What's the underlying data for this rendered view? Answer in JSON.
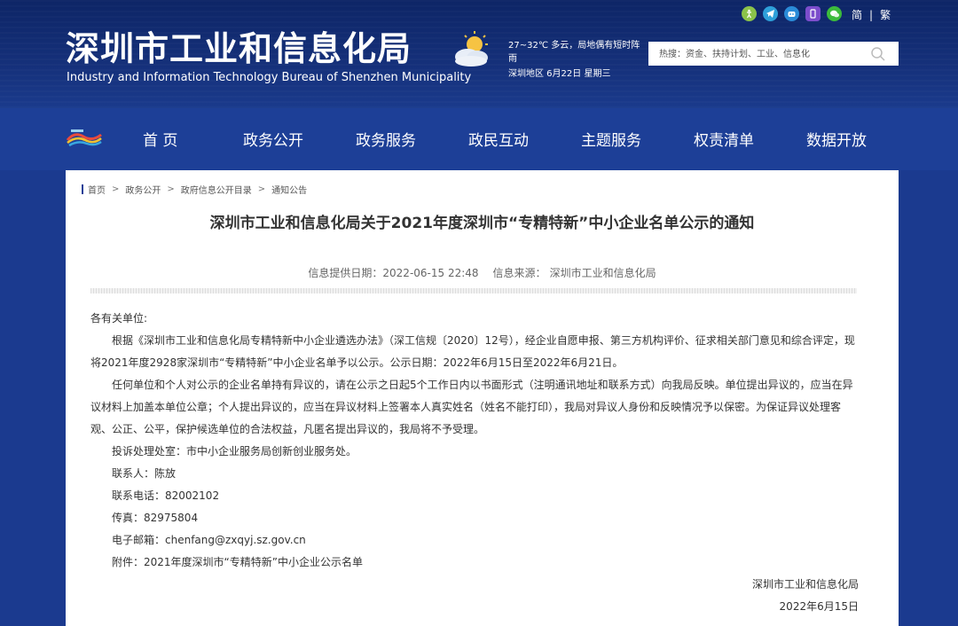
{
  "header": {
    "title": "深圳市工业和信息化局",
    "subtitle": "Industry and Information Technology Bureau of Shenzhen Municipality",
    "weather": {
      "summary": "27~32℃ 多云，局地偶有短时阵雨",
      "date_line": "深圳地区 6月22日 星期三"
    },
    "search_placeholder": "热搜：资金、扶持计划、工业、信息化",
    "lang": {
      "simplified": "简",
      "separator": "|",
      "traditional": "繁"
    },
    "icons": [
      {
        "name": "accessibility-icon",
        "color": "#8bc34a"
      },
      {
        "name": "telegram-icon",
        "color": "#2ea0da"
      },
      {
        "name": "robot-icon",
        "color": "#2a8bd8"
      },
      {
        "name": "mobile-icon",
        "color": "#7c4dcc"
      },
      {
        "name": "wechat-icon",
        "color": "#3cbb3c"
      }
    ]
  },
  "nav": {
    "items": [
      "首 页",
      "政务公开",
      "政务服务",
      "政民互动",
      "主题服务",
      "权责清单",
      "数据开放"
    ]
  },
  "breadcrumb": [
    "首页",
    "政务公开",
    "政府信息公开目录",
    "通知公告"
  ],
  "breadcrumb_sep": ">",
  "article": {
    "title": "深圳市工业和信息化局关于2021年度深圳市“专精特新”中小企业名单公示的通知",
    "date_label": "信息提供日期：2022-06-15 22:48",
    "source_label": "信息来源：",
    "source_value": "深圳市工业和信息化局",
    "salutation": "各有关单位:",
    "para1": "根据《深圳市工业和信息化局专精特新中小企业遴选办法》（深工信规〔2020〕12号），经企业自愿申报、第三方机构评价、征求相关部门意见和综合评定，现将2021年度2928家深圳市“专精特新”中小企业名单予以公示。公示日期：2022年6月15日至2022年6月21日。",
    "para2": "任何单位和个人对公示的企业名单持有异议的，请在公示之日起5个工作日内以书面形式（注明通讯地址和联系方式）向我局反映。单位提出异议的，应当在异议材料上加盖本单位公章；个人提出异议的，应当在异议材料上签署本人真实姓名（姓名不能打印），我局对异议人身份和反映情况予以保密。为保证异议处理客观、公正、公平，保护候选单位的合法权益，凡匿名提出异议的，我局将不予受理。",
    "office": "投诉处理处室：市中小企业服务局创新创业服务处。",
    "contact_person": "联系人：陈放",
    "phone": "联系电话：82002102",
    "fax": "传真：82975804",
    "email": "电子邮箱：chenfang@zxqyj.sz.gov.cn",
    "attachment": "附件：2021年度深圳市“专精特新”中小企业公示名单",
    "signature": "深圳市工业和信息化局",
    "sign_date": "2022年6月15日"
  }
}
